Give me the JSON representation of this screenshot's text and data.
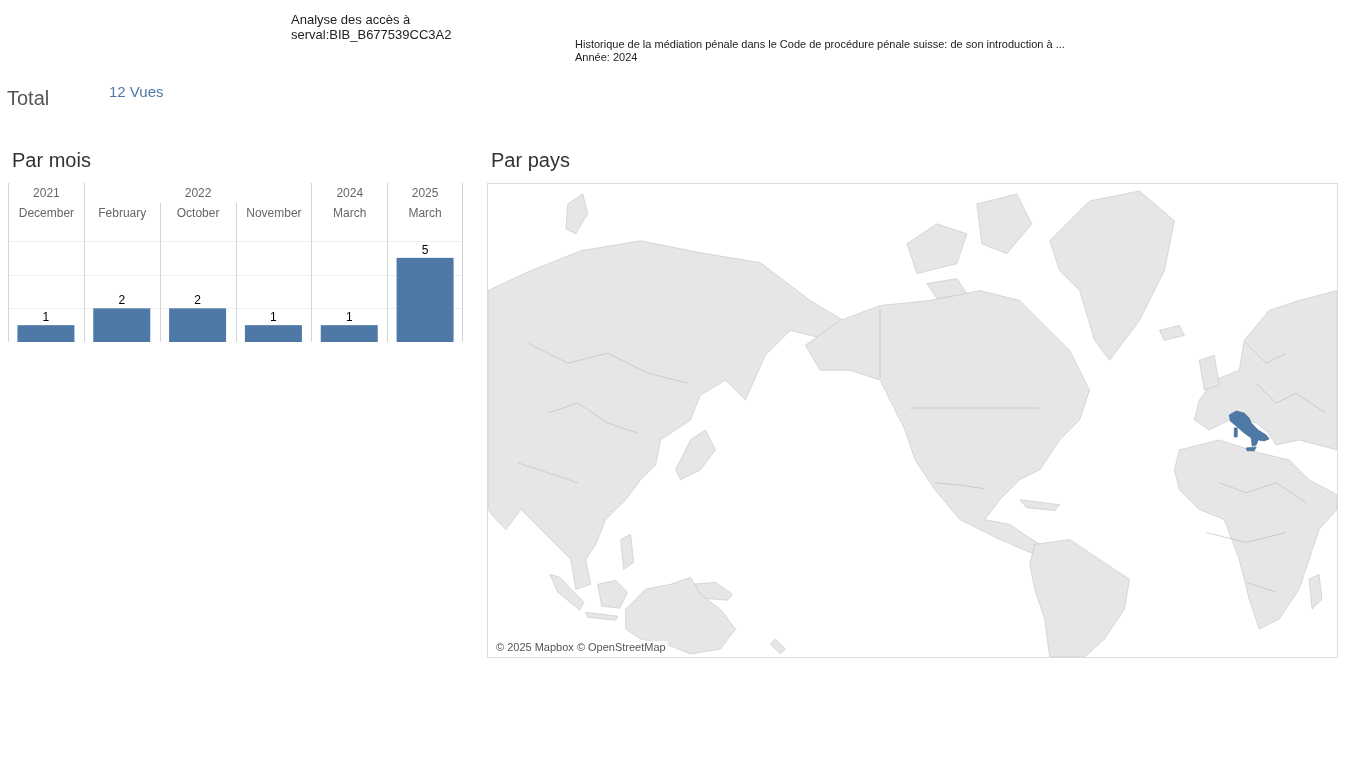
{
  "header": {
    "title": "Analyse des accès à serval:BIB_B677539CC3A2",
    "document": "Historique de la médiation pénale dans le Code de procédure pénale suisse: de son introduction à ...",
    "year": "Année: 2024"
  },
  "total": {
    "label": "Total",
    "value": "12 Vues"
  },
  "by_month": {
    "title": "Par mois",
    "year_headers": [
      "2021",
      "2022",
      "2024",
      "2025"
    ],
    "year_starts": [
      true,
      true,
      false,
      false,
      true,
      true
    ],
    "chart_data": {
      "type": "bar",
      "categories": [
        "December",
        "February",
        "October",
        "November",
        "March",
        "March"
      ],
      "values": [
        1,
        2,
        2,
        1,
        1,
        5
      ],
      "data_labels": true
    }
  },
  "by_country": {
    "title": "Par pays",
    "attribution": "© 2025 Mapbox © OpenStreetMap"
  }
}
